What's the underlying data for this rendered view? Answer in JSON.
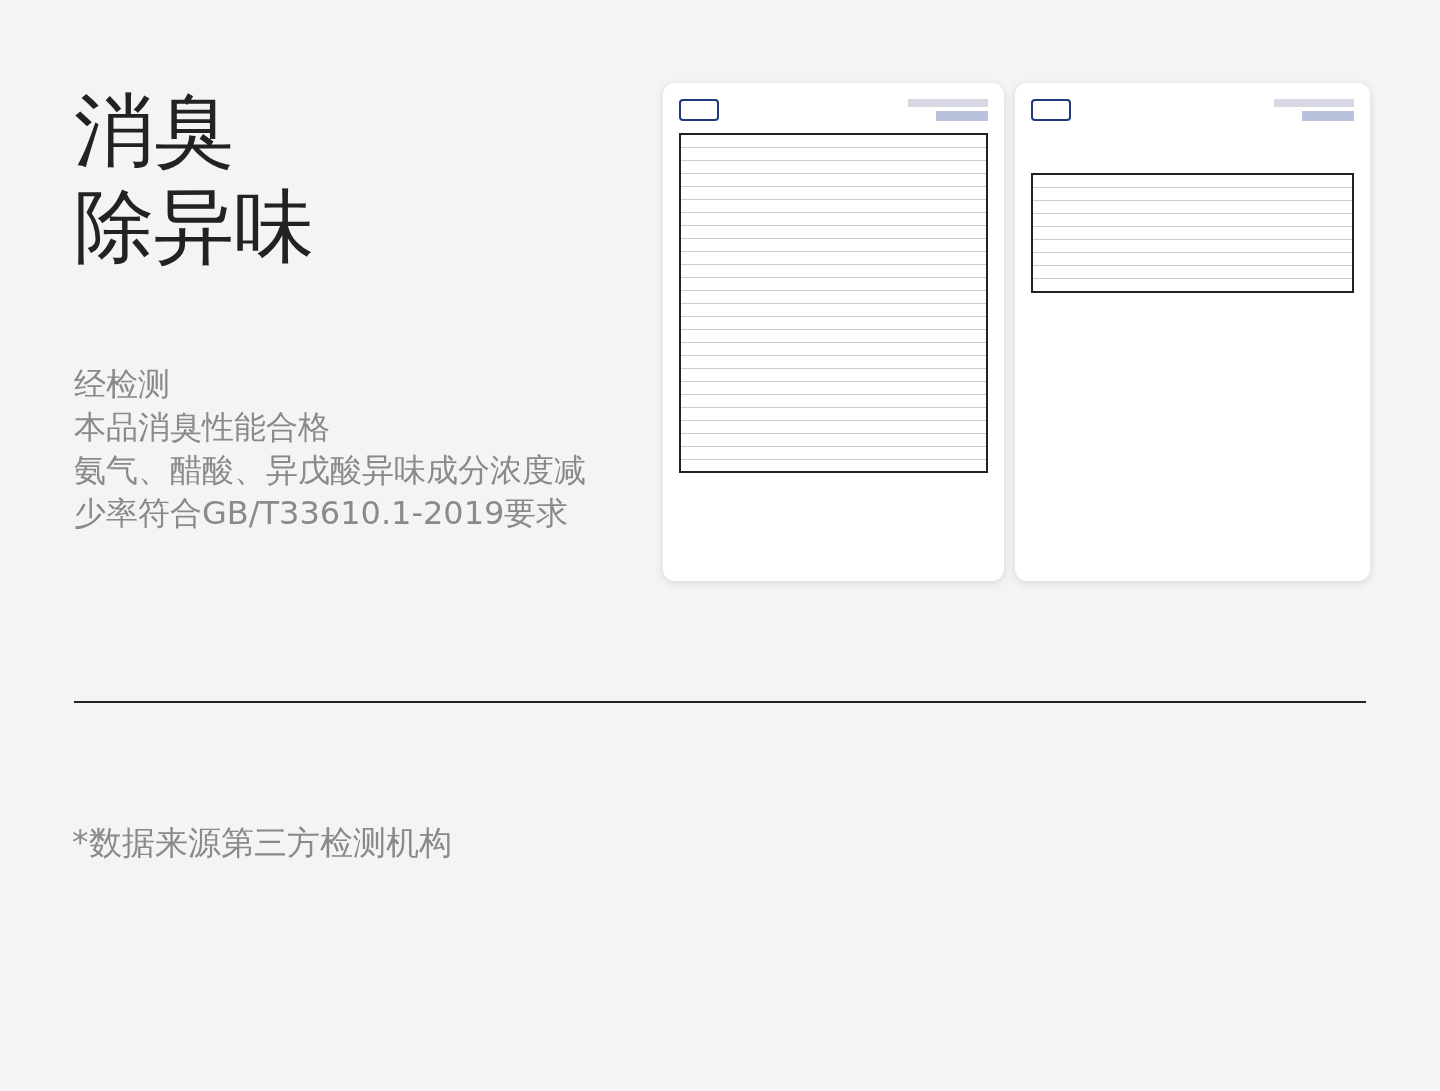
{
  "title_lines": [
    "消臭",
    "除异味"
  ],
  "description_lines": [
    "经检测",
    "本品消臭性能合格",
    "氨气、醋酸、异戊酸异味成分浓度减",
    "少率符合GB/T33610.1-2019要求"
  ],
  "footnote": "*数据来源第三方检测机构"
}
